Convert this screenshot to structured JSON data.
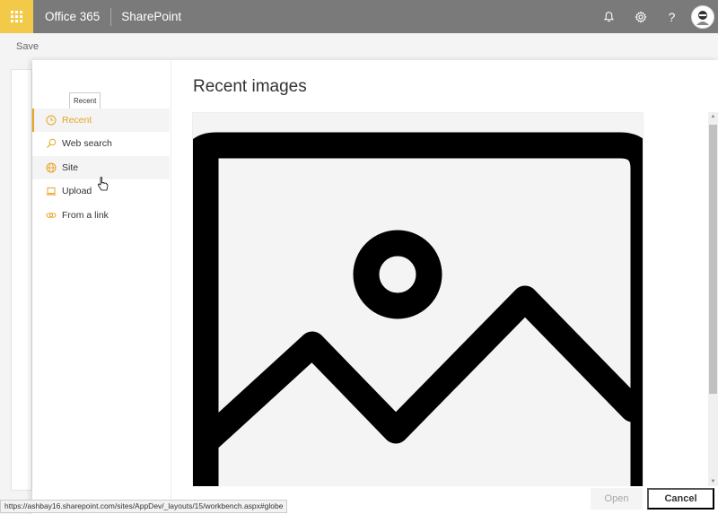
{
  "suitebar": {
    "brand": "Office 365",
    "app_name": "SharePoint",
    "icons": [
      "bell-icon",
      "gear-icon",
      "help-icon"
    ],
    "help_glyph": "?"
  },
  "background_page": {
    "save_text": "Save"
  },
  "panel": {
    "tooltip": "Recent",
    "nav_items": [
      {
        "label": "Recent",
        "icon": "clock-icon",
        "selected": true
      },
      {
        "label": "Web search",
        "icon": "search-icon",
        "selected": false
      },
      {
        "label": "Site",
        "icon": "globe-icon",
        "selected": false
      },
      {
        "label": "Upload",
        "icon": "laptop-icon",
        "selected": false
      },
      {
        "label": "From a link",
        "icon": "link-icon",
        "selected": false
      }
    ],
    "title": "Recent images",
    "buttons": {
      "open": "Open",
      "cancel": "Cancel"
    }
  },
  "statusbar": {
    "url": "https://ashbay16.sharepoint.com/sites/AppDev/_layouts/15/workbench.aspx#globe"
  },
  "colors": {
    "accent": "#e8a523",
    "suitebar": "#7a7a7a",
    "waffle": "#f3c94a"
  }
}
